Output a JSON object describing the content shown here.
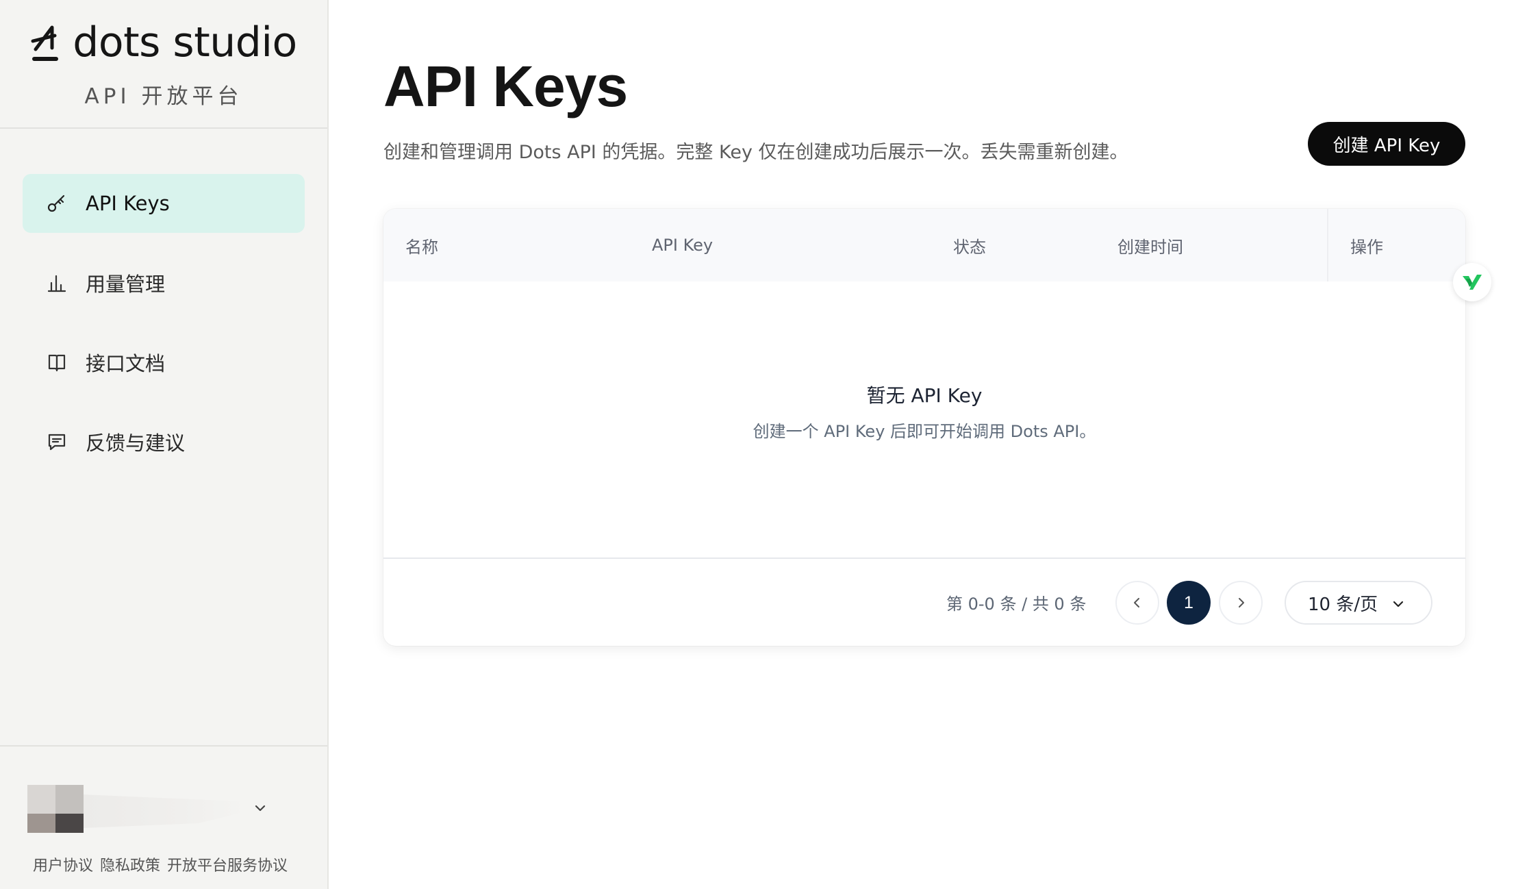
{
  "brand": {
    "name": "dots studio",
    "subtitle": "API 开放平台"
  },
  "sidebar": {
    "items": [
      {
        "label": "API Keys",
        "icon": "key-icon",
        "active": true
      },
      {
        "label": "用量管理",
        "icon": "bar-chart-icon",
        "active": false
      },
      {
        "label": "接口文档",
        "icon": "book-icon",
        "active": false
      },
      {
        "label": "反馈与建议",
        "icon": "message-icon",
        "active": false
      }
    ],
    "footer_links": [
      "用户协议",
      "隐私政策",
      "开放平台服务协议"
    ]
  },
  "header": {
    "title": "API Keys",
    "description": "创建和管理调用 Dots API 的凭据。完整 Key 仅在创建成功后展示一次。丢失需重新创建。",
    "create_button": "创建 API Key"
  },
  "table": {
    "columns": [
      "名称",
      "API Key",
      "状态",
      "创建时间",
      "操作"
    ],
    "rows": [],
    "empty_title": "暂无 API Key",
    "empty_desc": "创建一个 API Key 后即可开始调用 Dots API。"
  },
  "pagination": {
    "range_text": "第 0-0 条 / 共 0 条",
    "current_page": "1",
    "page_size": "10 条/页"
  },
  "colors": {
    "accent_active_bg": "#d9f3ed",
    "primary_button": "#0b0b0b",
    "page_current": "#0e2440"
  }
}
